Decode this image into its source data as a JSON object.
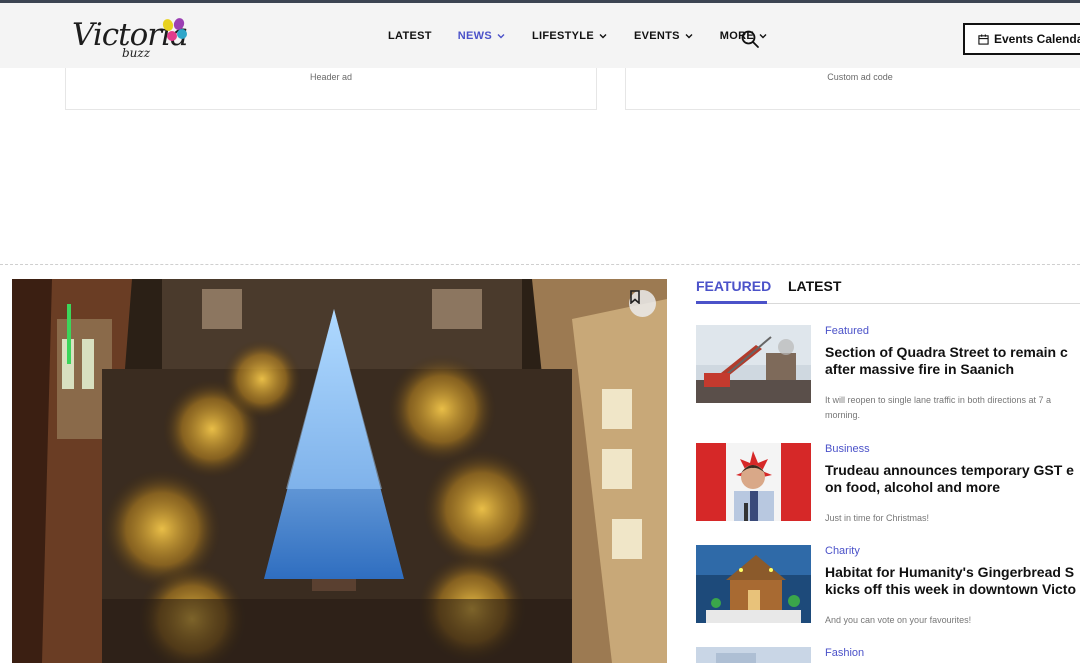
{
  "brand": {
    "logo_word": "Victoria",
    "logo_sub": "buzz",
    "colors": {
      "accent": "#4b52c9",
      "header_bg": "#f4f4f4",
      "text": "#111111"
    }
  },
  "nav": {
    "items": [
      {
        "label": "LATEST",
        "has_dropdown": false,
        "active": false
      },
      {
        "label": "NEWS",
        "has_dropdown": true,
        "active": true
      },
      {
        "label": "LIFESTYLE",
        "has_dropdown": true,
        "active": false
      },
      {
        "label": "EVENTS",
        "has_dropdown": true,
        "active": false
      },
      {
        "label": "MORE",
        "has_dropdown": true,
        "active": false
      }
    ],
    "search_icon": "search-icon",
    "events_button": {
      "icon": "calendar-icon",
      "label": "Events Calendar"
    }
  },
  "ads": {
    "left": "Header ad",
    "right": "Custom ad code"
  },
  "hero": {
    "bookmark_icon": "bookmark-icon"
  },
  "sidebar": {
    "tabs": [
      {
        "label": "FEATURED",
        "active": true
      },
      {
        "label": "LATEST",
        "active": false
      }
    ],
    "articles": [
      {
        "category": "Featured",
        "headline": "Section of Quadra Street to remain c\nafter massive fire in Saanich",
        "excerpt": "It will reopen to single lane traffic in both directions at 7 a\nmorning."
      },
      {
        "category": "Business",
        "headline": "Trudeau announces temporary GST e\non food, alcohol and more",
        "excerpt": "Just in time for Christmas!"
      },
      {
        "category": "Charity",
        "headline": "Habitat for Humanity's Gingerbread S\nkicks off this week in downtown Victo",
        "excerpt": "And you can vote on your favourites!"
      },
      {
        "category": "Fashion",
        "headline": "",
        "excerpt": ""
      }
    ]
  }
}
